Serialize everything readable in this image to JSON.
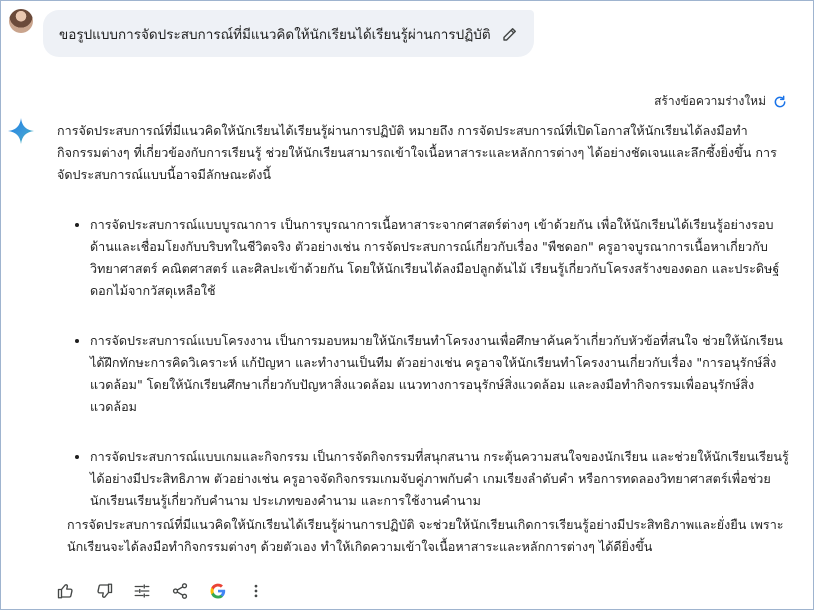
{
  "prompt": {
    "text": "ขอรูปแบบการจัดประสบการณ์ที่มีแนวคิดให้นักเรียนได้เรียนรู้ผ่านการปฏิบัติ"
  },
  "regenerate": {
    "label": "สร้างข้อความร่างใหม่"
  },
  "response": {
    "intro": "การจัดประสบการณ์ที่มีแนวคิดให้นักเรียนได้เรียนรู้ผ่านการปฏิบัติ หมายถึง การจัดประสบการณ์ที่เปิดโอกาสให้นักเรียนได้ลงมือทำกิจกรรมต่างๆ ที่เกี่ยวข้องกับการเรียนรู้ ช่วยให้นักเรียนสามารถเข้าใจเนื้อหาสาระและหลักการต่างๆ ได้อย่างชัดเจนและลึกซึ้งยิ่งขึ้น การจัดประสบการณ์แบบนี้อาจมีลักษณะดังนี้",
    "items": [
      "การจัดประสบการณ์แบบบูรณาการ เป็นการบูรณาการเนื้อหาสาระจากศาสตร์ต่างๆ เข้าด้วยกัน เพื่อให้นักเรียนได้เรียนรู้อย่างรอบด้านและเชื่อมโยงกับบริบทในชีวิตจริง ตัวอย่างเช่น การจัดประสบการณ์เกี่ยวกับเรื่อง \"พืชดอก\" ครูอาจบูรณาการเนื้อหาเกี่ยวกับวิทยาศาสตร์ คณิตศาสตร์ และศิลปะเข้าด้วยกัน โดยให้นักเรียนได้ลงมือปลูกต้นไม้ เรียนรู้เกี่ยวกับโครงสร้างของดอก และประดิษฐ์ดอกไม้จากวัสดุเหลือใช้",
      "การจัดประสบการณ์แบบโครงงาน เป็นการมอบหมายให้นักเรียนทำโครงงานเพื่อศึกษาค้นคว้าเกี่ยวกับหัวข้อที่สนใจ ช่วยให้นักเรียนได้ฝึกทักษะการคิดวิเคราะห์ แก้ปัญหา และทำงานเป็นทีม ตัวอย่างเช่น ครูอาจให้นักเรียนทำโครงงานเกี่ยวกับเรื่อง \"การอนุรักษ์สิ่งแวดล้อม\" โดยให้นักเรียนศึกษาเกี่ยวกับปัญหาสิ่งแวดล้อม แนวทางการอนุรักษ์สิ่งแวดล้อม และลงมือทำกิจกรรมเพื่ออนุรักษ์สิ่งแวดล้อม",
      "การจัดประสบการณ์แบบเกมและกิจกรรม เป็นการจัดกิจกรรมที่สนุกสนาน กระตุ้นความสนใจของนักเรียน และช่วยให้นักเรียนเรียนรู้ได้อย่างมีประสิทธิภาพ ตัวอย่างเช่น ครูอาจจัดกิจกรรมเกมจับคู่ภาพกับคำ เกมเรียงลำดับคำ หรือการทดลองวิทยาศาสตร์เพื่อช่วยนักเรียนเรียนรู้เกี่ยวกับคำนาม ประเภทของคำนาม และการใช้งานคำนาม"
    ],
    "closing": "การจัดประสบการณ์ที่มีแนวคิดให้นักเรียนได้เรียนรู้ผ่านการปฏิบัติ จะช่วยให้นักเรียนเกิดการเรียนรู้อย่างมีประสิทธิภาพและยั่งยืน เพราะนักเรียนจะได้ลงมือทำกิจกรรมต่างๆ ด้วยตัวเอง ทำให้เกิดความเข้าใจเนื้อหาสาระและหลักการต่างๆ ได้ดียิ่งขึ้น"
  },
  "actions": [
    "thumb-up-icon",
    "thumb-down-icon",
    "tune-icon",
    "share-icon",
    "google-icon",
    "more-vert-icon"
  ],
  "colors": {
    "accent_blue": "#1a73e8",
    "bubble": "#eef1f6",
    "text": "#1f1f1f",
    "icon": "#444746"
  }
}
